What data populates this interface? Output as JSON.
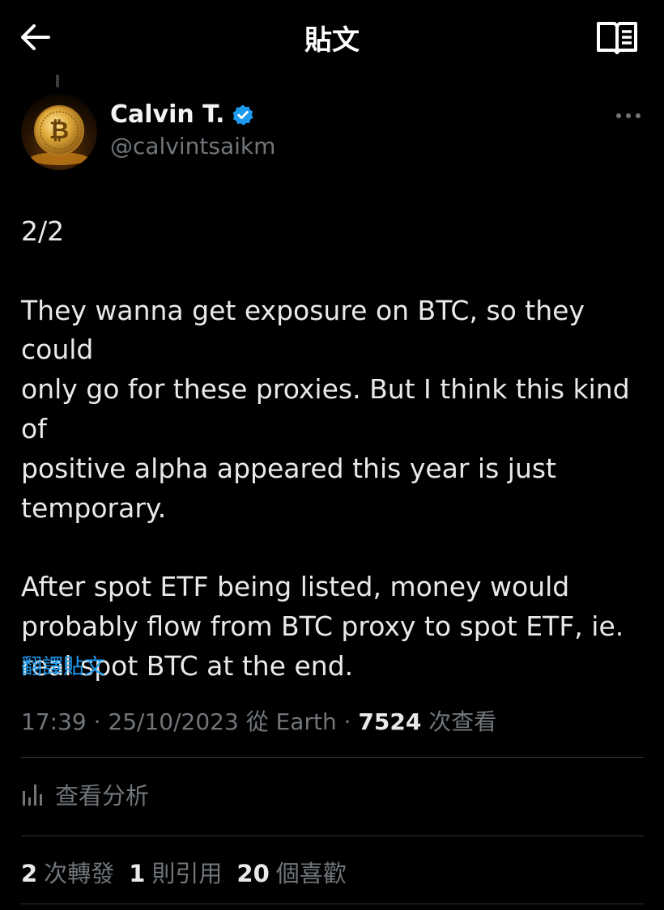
{
  "header": {
    "title": "貼文",
    "back_icon": "arrow-left-icon",
    "reader_icon": "open-book-icon"
  },
  "author": {
    "name": "Calvin T.",
    "handle": "@calvintsaikm",
    "verified": true,
    "verified_color": "#1d9bf0",
    "avatar": "bitcoin-coin-avatar"
  },
  "post": {
    "text": "2/2\n\nThey wanna get exposure on BTC, so they could\nonly go for these proxies. But I think this kind of\npositive alpha appeared this year is just\ntemporary.\n\nAfter spot ETF being listed, money would\nprobably flow from BTC proxy to spot ETF, ie.\nreal spot BTC at the end.",
    "translate_label": "翻譯貼文"
  },
  "meta": {
    "time": "17:39",
    "sep1": " · ",
    "date": "25/10/2023",
    "source": " 從 Earth",
    "sep2": " · ",
    "views_count": "7524",
    "views_label": " 次查看"
  },
  "analytics": {
    "label": "查看分析",
    "icon": "bar-chart-icon"
  },
  "stats": {
    "reposts_count": "2",
    "reposts_label": "次轉發",
    "quotes_count": "1",
    "quotes_label": "則引用",
    "likes_count": "20",
    "likes_label": "個喜歡"
  },
  "colors": {
    "background": "#000000",
    "primary_text": "#e7e9ea",
    "secondary_text": "#71767b",
    "link": "#1d9bf0",
    "divider": "#2f3336"
  }
}
